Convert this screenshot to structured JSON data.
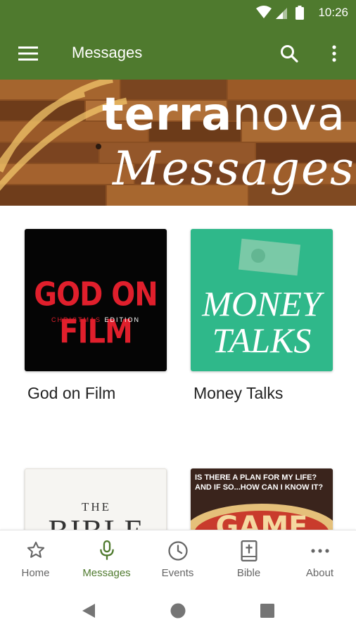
{
  "status_bar": {
    "time": "10:26"
  },
  "app_bar": {
    "title": "Messages"
  },
  "banner": {
    "brand_bold": "terra",
    "brand_light": "nova",
    "subtitle": "Messages"
  },
  "series": [
    {
      "label": "God on Film",
      "art_title": "GOD ON FILM",
      "art_sub_1": "CHRISTMAS",
      "art_sub_2": " EDITION",
      "color": "#050505"
    },
    {
      "label": "Money Talks",
      "art_title_1": "MONEY",
      "art_title_2": "TALKS",
      "color": "#2fb88a"
    },
    {
      "art_title_1": "THE",
      "art_title_2": "BIBLE",
      "color": "#f6f5f2"
    },
    {
      "art_caption": "IS THERE A PLAN FOR MY LIFE? AND IF SO...HOW CAN I KNOW IT?",
      "color": "#3a241c"
    }
  ],
  "bottom_nav": [
    {
      "label": "Home",
      "icon": "star-icon"
    },
    {
      "label": "Messages",
      "icon": "microphone-icon",
      "active": true
    },
    {
      "label": "Events",
      "icon": "clock-icon"
    },
    {
      "label": "Bible",
      "icon": "bible-icon"
    },
    {
      "label": "About",
      "icon": "more-horizontal-icon"
    }
  ],
  "colors": {
    "primary": "#4f7a2e",
    "nav_inactive": "#666666"
  }
}
